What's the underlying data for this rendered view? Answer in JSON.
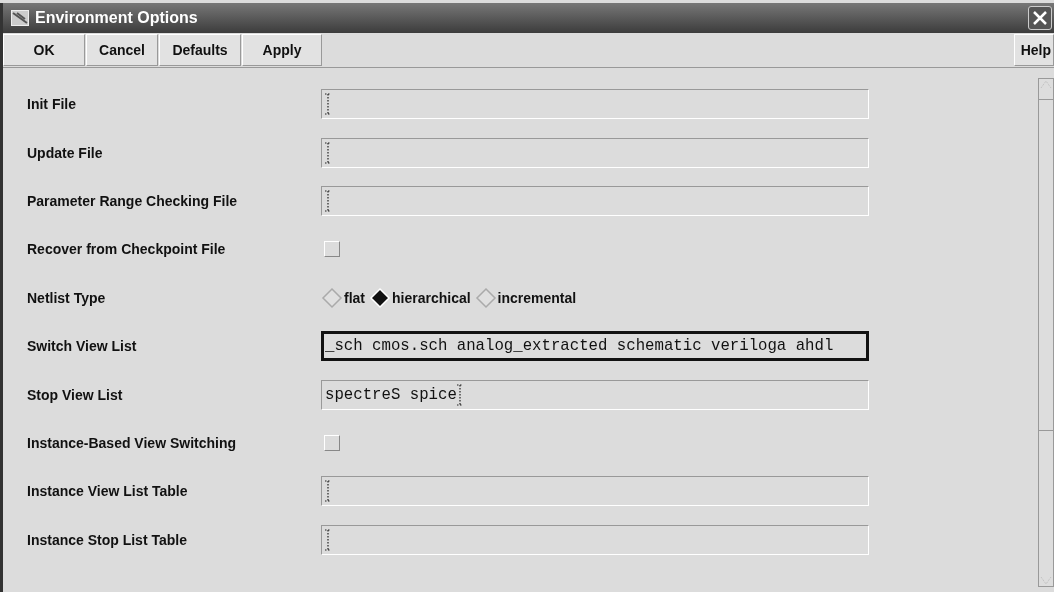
{
  "window": {
    "title": "Environment Options"
  },
  "buttons": [
    {
      "label": "OK"
    },
    {
      "label": "Cancel"
    },
    {
      "label": "Defaults"
    },
    {
      "label": "Apply"
    }
  ],
  "help_button": {
    "label": "Help"
  },
  "rows": [
    {
      "kind": "text",
      "label": "Init File",
      "focused": false
    },
    {
      "kind": "text",
      "label": "Update File",
      "focused": false
    },
    {
      "kind": "text",
      "label": "Parameter Range Checking File",
      "focused": false
    },
    {
      "kind": "checkbox",
      "label": "Recover from Checkpoint File",
      "checked": false
    },
    {
      "kind": "radio",
      "label": "Netlist Type",
      "options": [
        {
          "label": "flat",
          "selected": false
        },
        {
          "label": "hierarchical",
          "selected": true
        },
        {
          "label": "incremental",
          "selected": false
        }
      ]
    },
    {
      "kind": "text",
      "label": "Switch View List",
      "value": "_sch cmos.sch analog_extracted schematic veriloga ahdl",
      "focused": true
    },
    {
      "kind": "text",
      "label": "Stop View List",
      "value": "spectreS spice",
      "focused": false
    },
    {
      "kind": "checkbox",
      "label": "Instance-Based View Switching",
      "checked": false
    },
    {
      "kind": "text",
      "label": "Instance View List Table",
      "focused": false
    },
    {
      "kind": "text",
      "label": "Instance Stop List Table",
      "focused": false
    }
  ]
}
